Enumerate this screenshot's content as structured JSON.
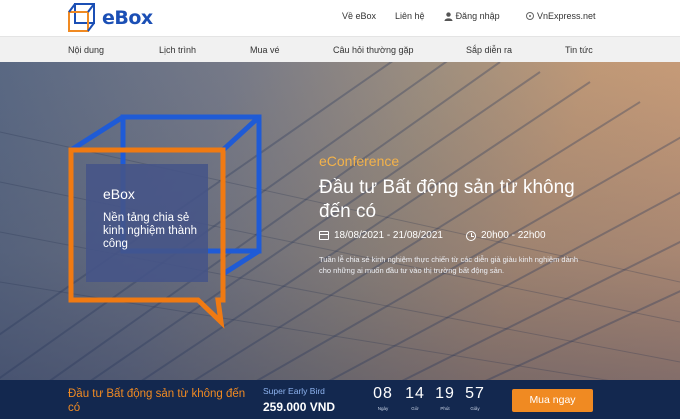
{
  "header": {
    "logo_text": "eBox",
    "links": [
      "Về eBox",
      "Liên hệ"
    ],
    "login_label": "Đăng nhập",
    "vnexpress_label": "VnExpress.net"
  },
  "nav": {
    "items": [
      "Nội dung",
      "Lịch trình",
      "Mua vé",
      "Câu hỏi thường gặp",
      "Sắp diễn ra",
      "Tin tức"
    ]
  },
  "hero": {
    "brand": "eBox",
    "tagline": "Nền tảng chia sẻ kinh nghiệm thành công",
    "event_type": "eConference",
    "event_title": "Đầu tư Bất động sản từ không đến có",
    "date_range": "18/08/2021 - 21/08/2021",
    "time_range": "20h00 - 22h00",
    "description": "Tuần lễ chia sẻ kinh nghiệm thực chiến từ các diễn giả giàu kinh nghiệm dành cho những ai muốn đầu tư vào thị trường bất động sản."
  },
  "bottom_bar": {
    "event_title": "Đầu tư Bất động sản từ không đến có",
    "ticket_plan": "Super Early Bird",
    "price": "259.000 VND",
    "countdown": [
      {
        "value": "08",
        "label": "Ngày"
      },
      {
        "value": "14",
        "label": "Giờ"
      },
      {
        "value": "19",
        "label": "Phút"
      },
      {
        "value": "57",
        "label": "Giây"
      }
    ],
    "buy_label": "Mua ngay"
  },
  "colors": {
    "brand_blue": "#1b4fb5",
    "accent_orange": "#f08a22",
    "bottom_bar_bg": "#13284f",
    "event_type_color": "#f3b24a"
  },
  "icons": [
    "ebox-cube-logo-icon",
    "user-icon",
    "vnexpress-icon",
    "calendar-icon",
    "clock-icon"
  ]
}
